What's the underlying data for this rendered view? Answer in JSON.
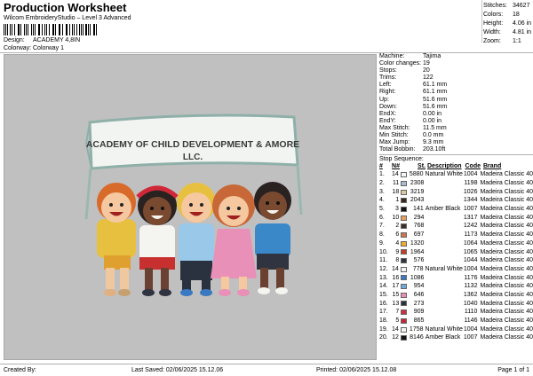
{
  "header": {
    "title": "Production Worksheet",
    "subtitle": "Wilcom EmbroideryStudio – Level 3 Advanced",
    "design_label": "Design:",
    "design_value": "ACADEMY 4,8IN",
    "colorway_label": "Colorway:",
    "colorway_value": "Colorway 1"
  },
  "stats": [
    {
      "label": "Stitches:",
      "value": "34627"
    },
    {
      "label": "Colors:",
      "value": "18"
    },
    {
      "label": "Height:",
      "value": "4.06 in"
    },
    {
      "label": "Width:",
      "value": "4.81 in"
    },
    {
      "label": "Zoom:",
      "value": "1:1"
    }
  ],
  "design": {
    "banner_line1": "ACADEMY OF CHILD DEVELOPMENT & AMORE",
    "banner_line2": "LLC."
  },
  "machine": [
    {
      "label": "Machine:",
      "value": "Tajima"
    },
    {
      "label": "Color changes:",
      "value": "19"
    },
    {
      "label": "Stops:",
      "value": "20"
    },
    {
      "label": "Trims:",
      "value": "122"
    },
    {
      "label": "Left:",
      "value": "61.1 mm"
    },
    {
      "label": "Right:",
      "value": "61.1 mm"
    },
    {
      "label": "Up:",
      "value": "51.6 mm"
    },
    {
      "label": "Down:",
      "value": "51.6 mm"
    },
    {
      "label": "EndX:",
      "value": "0.00 in"
    },
    {
      "label": "EndY:",
      "value": "0.00 in"
    },
    {
      "label": "Max Stitch:",
      "value": "11.5 mm"
    },
    {
      "label": "Min Stitch:",
      "value": "0.0 mm"
    },
    {
      "label": "Max Jump:",
      "value": "9.3 mm"
    },
    {
      "label": "Total Bobbin:",
      "value": "203.10ft"
    }
  ],
  "sequence": {
    "title": "Stop Sequence:",
    "columns": {
      "num": "#",
      "n": "N#",
      "st": "St.",
      "desc": "Description",
      "code": "Code",
      "brand": "Brand"
    },
    "rows": [
      {
        "num": "1.",
        "n": "14",
        "color": "#f4f4f0",
        "st": "5880",
        "desc": "Natural White",
        "code": "1004",
        "brand": "Madeira Classic 40"
      },
      {
        "num": "2.",
        "n": "11",
        "color": "#a9bccd",
        "st": "2308",
        "desc": "",
        "code": "1198",
        "brand": "Madeira Classic 40"
      },
      {
        "num": "3.",
        "n": "18",
        "color": "#d9c9a0",
        "st": "3219",
        "desc": "",
        "code": "1026",
        "brand": "Madeira Classic 40"
      },
      {
        "num": "4.",
        "n": "1",
        "color": "#3a2a22",
        "st": "2043",
        "desc": "",
        "code": "1344",
        "brand": "Madeira Classic 40"
      },
      {
        "num": "5.",
        "n": "3",
        "color": "#141414",
        "st": "141",
        "desc": "Amber Black",
        "code": "1007",
        "brand": "Madeira Classic 40"
      },
      {
        "num": "6.",
        "n": "10",
        "color": "#e8a060",
        "st": "294",
        "desc": "",
        "code": "1317",
        "brand": "Madeira Classic 40"
      },
      {
        "num": "7.",
        "n": "2",
        "color": "#3a2f2a",
        "st": "768",
        "desc": "",
        "code": "1242",
        "brand": "Madeira Classic 40"
      },
      {
        "num": "8.",
        "n": "6",
        "color": "#c87850",
        "st": "697",
        "desc": "",
        "code": "1173",
        "brand": "Madeira Classic 40"
      },
      {
        "num": "9.",
        "n": "4",
        "color": "#e8b030",
        "st": "1320",
        "desc": "",
        "code": "1064",
        "brand": "Madeira Classic 40"
      },
      {
        "num": "10.",
        "n": "9",
        "color": "#c04030",
        "st": "1964",
        "desc": "",
        "code": "1065",
        "brand": "Madeira Classic 40"
      },
      {
        "num": "11.",
        "n": "8",
        "color": "#303440",
        "st": "576",
        "desc": "",
        "code": "1044",
        "brand": "Madeira Classic 40"
      },
      {
        "num": "12.",
        "n": "14",
        "color": "#f4f4f0",
        "st": "778",
        "desc": "Natural White",
        "code": "1004",
        "brand": "Madeira Classic 40"
      },
      {
        "num": "13.",
        "n": "16",
        "color": "#3a78c0",
        "st": "1086",
        "desc": "",
        "code": "1176",
        "brand": "Madeira Classic 40"
      },
      {
        "num": "14.",
        "n": "17",
        "color": "#70a8d8",
        "st": "954",
        "desc": "",
        "code": "1132",
        "brand": "Madeira Classic 40"
      },
      {
        "num": "15.",
        "n": "15",
        "color": "#e890b8",
        "st": "646",
        "desc": "",
        "code": "1362",
        "brand": "Madeira Classic 40"
      },
      {
        "num": "16.",
        "n": "13",
        "color": "#2a3240",
        "st": "273",
        "desc": "",
        "code": "1040",
        "brand": "Madeira Classic 40"
      },
      {
        "num": "17.",
        "n": "7",
        "color": "#c83040",
        "st": "909",
        "desc": "",
        "code": "1110",
        "brand": "Madeira Classic 40"
      },
      {
        "num": "18.",
        "n": "5",
        "color": "#c02838",
        "st": "865",
        "desc": "",
        "code": "1146",
        "brand": "Madeira Classic 40"
      },
      {
        "num": "19.",
        "n": "14",
        "color": "#f4f4f0",
        "st": "1758",
        "desc": "Natural White",
        "code": "1004",
        "brand": "Madeira Classic 40"
      },
      {
        "num": "20.",
        "n": "12",
        "color": "#141414",
        "st": "8146",
        "desc": "Amber Black",
        "code": "1007",
        "brand": "Madeira Classic 40"
      }
    ]
  },
  "footer": {
    "created_by": "Created By:",
    "last_saved": "Last Saved: 02/06/2025 15.12.06",
    "printed": "Printed: 02/06/2025 15.12.08",
    "page": "Page 1 of 1"
  }
}
